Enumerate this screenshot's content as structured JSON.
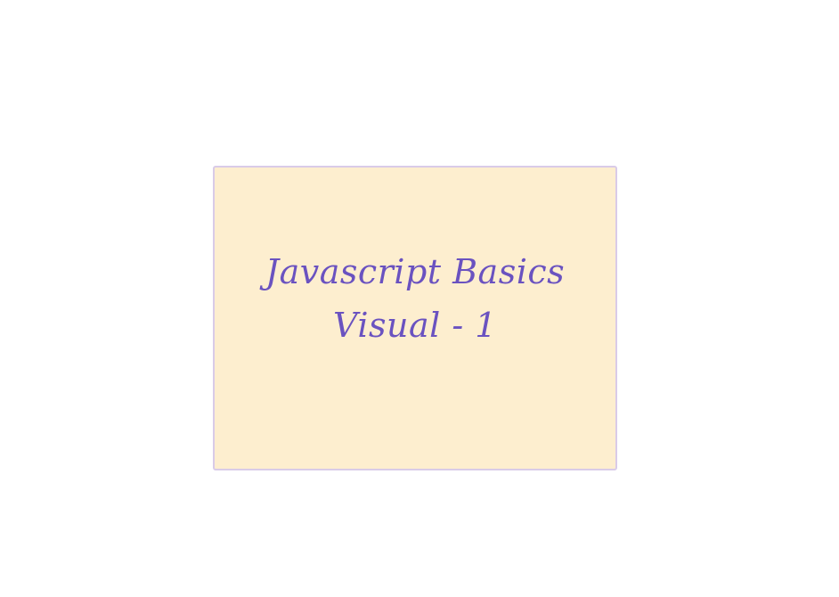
{
  "card": {
    "line1": "Javascript Basics",
    "line2": "Visual - 1",
    "background_color": "#fdeecf",
    "border_color": "#d9cbe8",
    "text_color": "#6a52c0"
  }
}
